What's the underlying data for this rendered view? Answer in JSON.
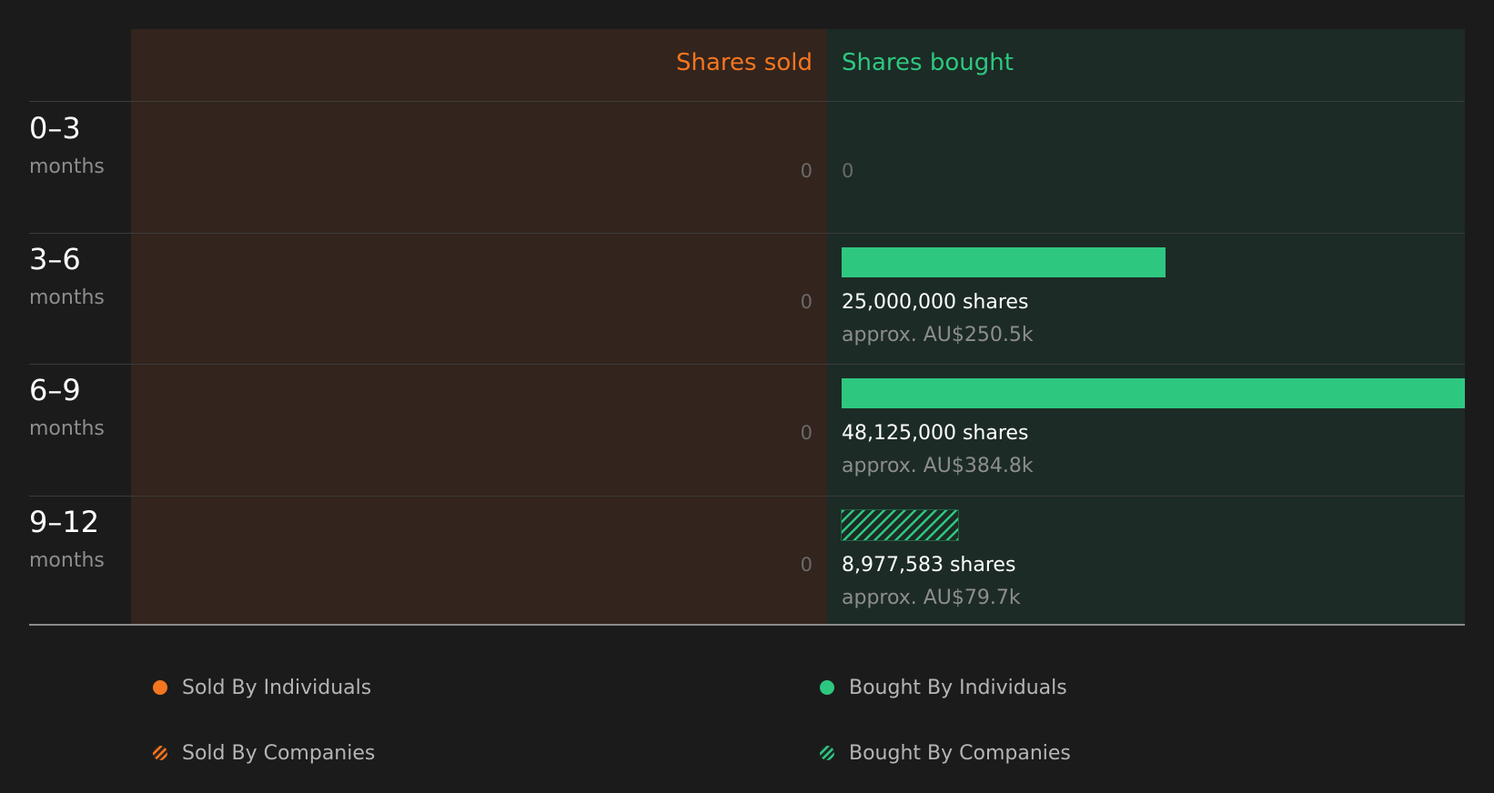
{
  "chart_data": {
    "type": "bar",
    "orientation": "horizontal-diverging",
    "header": {
      "sold": "Shares sold",
      "bought": "Shares bought"
    },
    "categories": [
      {
        "period": "0–3",
        "unit": "months"
      },
      {
        "period": "3–6",
        "unit": "months"
      },
      {
        "period": "6–9",
        "unit": "months"
      },
      {
        "period": "9–12",
        "unit": "months"
      }
    ],
    "series": [
      {
        "name": "Sold By Individuals",
        "values": [
          0,
          0,
          0,
          0
        ]
      },
      {
        "name": "Sold By Companies",
        "values": [
          0,
          0,
          0,
          0
        ]
      },
      {
        "name": "Bought By Individuals",
        "values": [
          0,
          25000000,
          48125000,
          0
        ]
      },
      {
        "name": "Bought By Companies",
        "values": [
          0,
          0,
          0,
          8977583
        ]
      }
    ],
    "rows": [
      {
        "sold_label": "0",
        "bought_label": "0",
        "shares_label": "",
        "approx_label": ""
      },
      {
        "sold_label": "0",
        "bought_label": "",
        "shares_label": "25,000,000 shares",
        "approx_label": "approx. AU$250.5k"
      },
      {
        "sold_label": "0",
        "bought_label": "",
        "shares_label": "48,125,000 shares",
        "approx_label": "approx. AU$384.8k"
      },
      {
        "sold_label": "0",
        "bought_label": "",
        "shares_label": "8,977,583 shares",
        "approx_label": "approx. AU$79.7k"
      }
    ],
    "legend": [
      {
        "label": "Sold By Individuals",
        "style": "solid",
        "color": "#f4761f"
      },
      {
        "label": "Bought By Individuals",
        "style": "solid",
        "color": "#2ec780"
      },
      {
        "label": "Sold By Companies",
        "style": "hatched",
        "color": "#f4761f"
      },
      {
        "label": "Bought By Companies",
        "style": "hatched",
        "color": "#2ec780"
      }
    ],
    "legend_position": "bottom",
    "colors": {
      "sold": "#f4761f",
      "bought": "#2ec780",
      "sold_bg": "#33241d",
      "bought_bg": "#1c2b25",
      "background": "#1b1b1b"
    }
  }
}
